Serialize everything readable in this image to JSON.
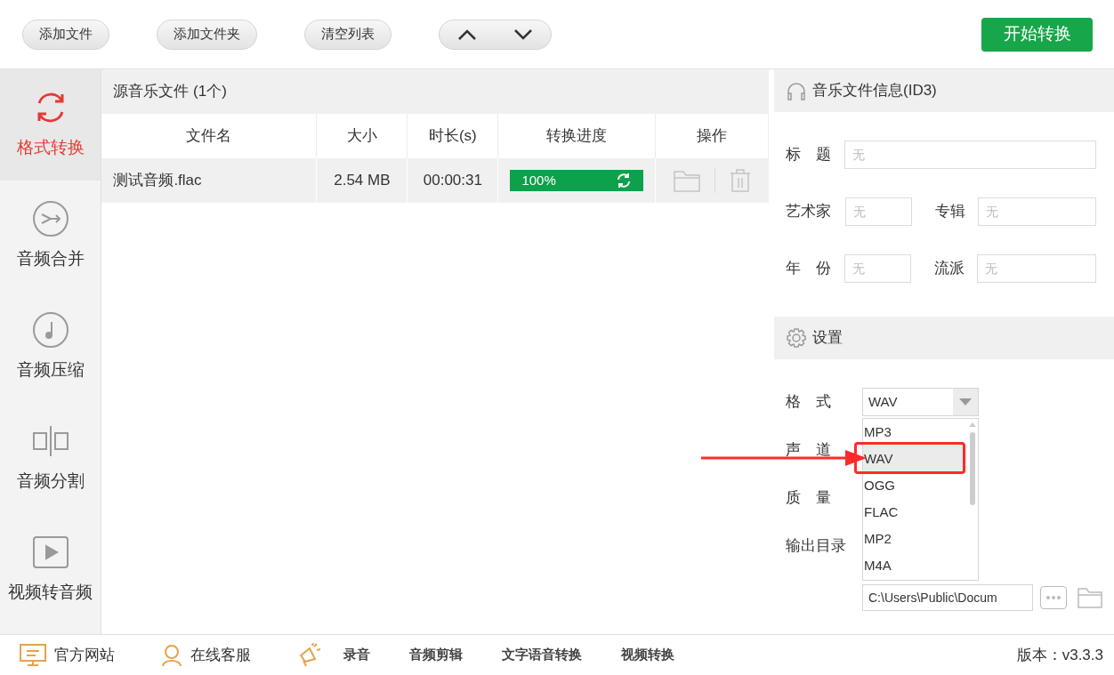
{
  "toolbar": {
    "buttons": [
      "添加文件",
      "添加文件夹",
      "清空列表"
    ],
    "start_button": "开始转换"
  },
  "sidebar": {
    "items": [
      {
        "label": "格式转换",
        "kind": "convert",
        "selected": true
      },
      {
        "label": "音频合并",
        "kind": "merge",
        "selected": false
      },
      {
        "label": "音频压缩",
        "kind": "compress",
        "selected": false
      },
      {
        "label": "音频分割",
        "kind": "split",
        "selected": false
      },
      {
        "label": "视频转音频",
        "kind": "video",
        "selected": false
      }
    ]
  },
  "file_list": {
    "title": "源音乐文件 (1个)",
    "columns": [
      "文件名",
      "大小",
      "时长(s)",
      "转换进度",
      "操作"
    ],
    "rows": [
      {
        "name": "测试音频.flac",
        "size": "2.54 MB",
        "duration": "00:00:31",
        "progress": {
          "level": 1,
          "label": "100%"
        }
      }
    ]
  },
  "id3": {
    "title": "音乐文件信息(ID3)",
    "fields": [
      {
        "label": "标　题",
        "placeholder": "无"
      },
      {
        "label": "艺术家",
        "placeholder": "无"
      },
      {
        "label": "专辑",
        "placeholder": "无"
      },
      {
        "label": "年　份",
        "placeholder": "无"
      },
      {
        "label": "流派",
        "placeholder": "无"
      }
    ]
  },
  "settings": {
    "title": "设置",
    "format_label": "格　式",
    "format_value": "WAV",
    "labels": [
      "声　道",
      "质　量",
      "输出目录"
    ],
    "options": [
      {
        "label": "MP3",
        "selected": false
      },
      {
        "label": "WAV",
        "selected": true
      },
      {
        "label": "OGG",
        "selected": false
      },
      {
        "label": "FLAC",
        "selected": false
      },
      {
        "label": "MP2",
        "selected": false
      },
      {
        "label": "M4A",
        "selected": false
      }
    ],
    "output_path": "C:\\Users\\Public\\Docum"
  },
  "footer": {
    "links": [
      {
        "label": "官方网站",
        "kind": "monitor"
      },
      {
        "label": "在线客服",
        "kind": "person"
      }
    ],
    "tools": [
      "录音",
      "音频剪辑",
      "文字语音转换",
      "视频转换"
    ],
    "version": "版本：v3.3.3"
  }
}
